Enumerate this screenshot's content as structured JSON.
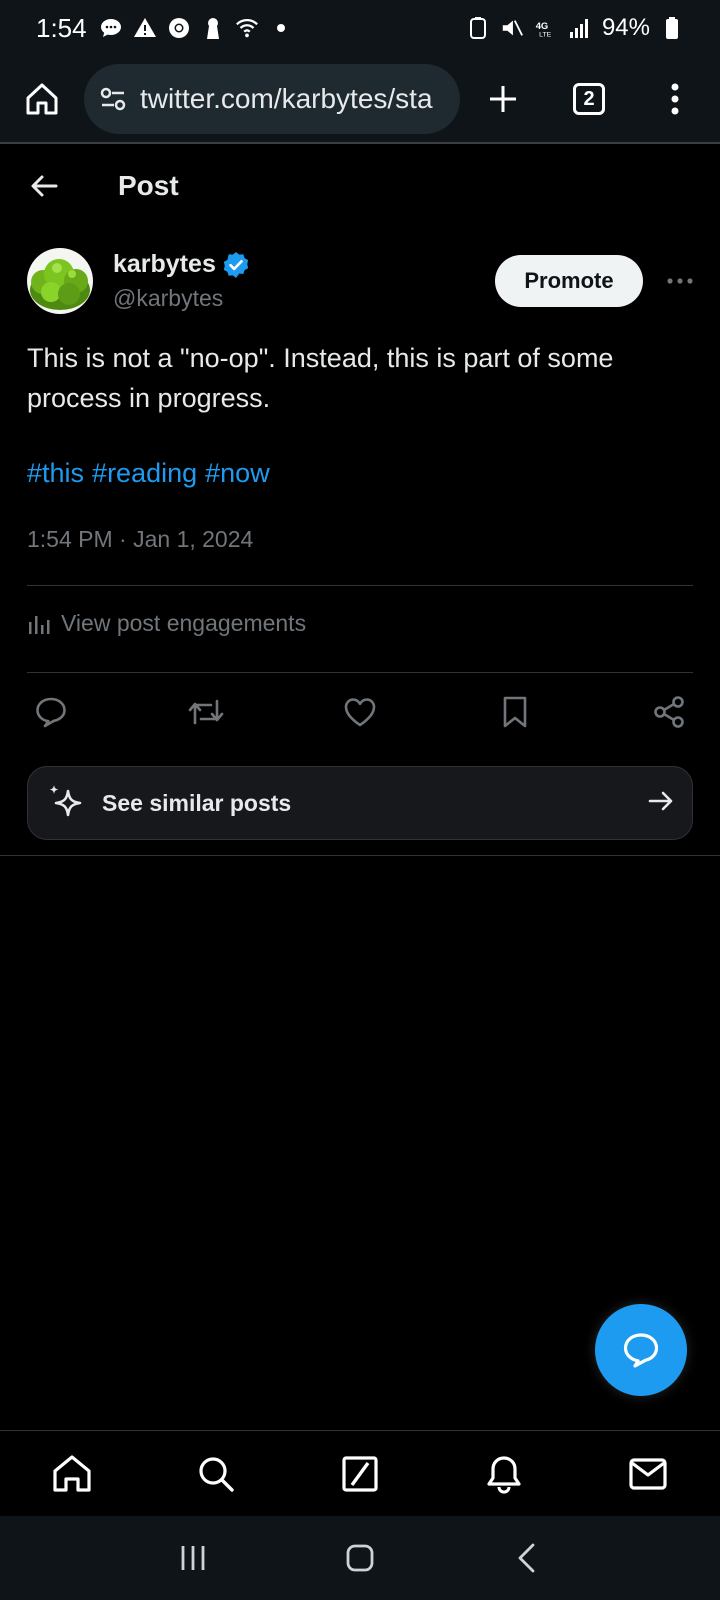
{
  "status_bar": {
    "time": "1:54",
    "battery": "94%",
    "network": "4G LTE"
  },
  "browser": {
    "url": "twitter.com/karbytes/sta",
    "tab_count": "2"
  },
  "header": {
    "title": "Post"
  },
  "post": {
    "author_name": "karbytes",
    "author_handle": "@karbytes",
    "verified": true,
    "promote_label": "Promote",
    "text": "This is not a \"no-op\". Instead, this is part of some process in progress.",
    "hashtags": [
      "#this",
      "#reading",
      "#now"
    ],
    "timestamp": "1:54 PM · Jan 1, 2024",
    "engagements_label": "View post engagements",
    "similar_label": "See similar posts"
  },
  "colors": {
    "accent": "#1d9bf0",
    "background": "#000000",
    "chrome": "#0f1419",
    "secondary_text": "#71767b"
  },
  "icons": {
    "actions": [
      "reply-icon",
      "repost-icon",
      "like-icon",
      "bookmark-icon",
      "share-icon"
    ],
    "bottom_nav": [
      "home-icon",
      "search-icon",
      "grok-icon",
      "notifications-icon",
      "messages-icon"
    ]
  }
}
